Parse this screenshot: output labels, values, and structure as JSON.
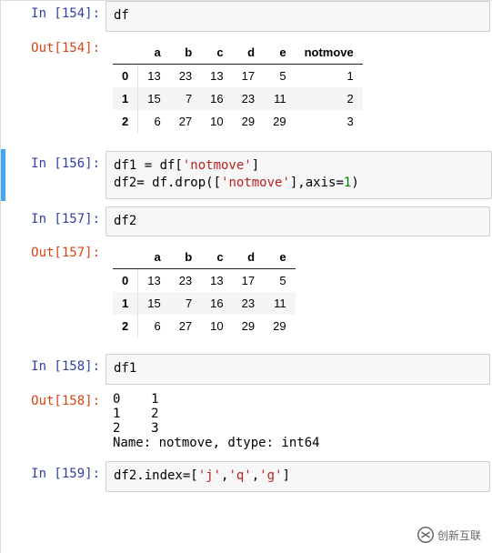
{
  "cells": {
    "c1": {
      "in_prompt": "In  [154]:",
      "code": "df"
    },
    "c1out": {
      "out_prompt": "Out[154]:",
      "table": {
        "columns": [
          "a",
          "b",
          "c",
          "d",
          "e",
          "notmove"
        ],
        "index": [
          "0",
          "1",
          "2"
        ],
        "data": [
          [
            13,
            23,
            13,
            17,
            5,
            1
          ],
          [
            15,
            7,
            16,
            23,
            11,
            2
          ],
          [
            6,
            27,
            10,
            29,
            29,
            3
          ]
        ]
      }
    },
    "c2": {
      "in_prompt": "In  [156]:",
      "tokens": {
        "t0": "df1 = df[",
        "t1": "'notmove'",
        "t2": "]\ndf2= df.drop([",
        "t3": "'notmove'",
        "t4": "],axis=",
        "t5": "1",
        "t6": ")"
      }
    },
    "c3": {
      "in_prompt": "In  [157]:",
      "code": "df2"
    },
    "c3out": {
      "out_prompt": "Out[157]:",
      "table": {
        "columns": [
          "a",
          "b",
          "c",
          "d",
          "e"
        ],
        "index": [
          "0",
          "1",
          "2"
        ],
        "data": [
          [
            13,
            23,
            13,
            17,
            5
          ],
          [
            15,
            7,
            16,
            23,
            11
          ],
          [
            6,
            27,
            10,
            29,
            29
          ]
        ]
      }
    },
    "c4": {
      "in_prompt": "In  [158]:",
      "code": "df1"
    },
    "c4out": {
      "out_prompt": "Out[158]:",
      "text": "0    1\n1    2\n2    3\nName: notmove, dtype: int64"
    },
    "c5": {
      "in_prompt": "In  [159]:",
      "tokens": {
        "t0": "df2.index=[",
        "t1": "'j'",
        "t2": ",",
        "t3": "'q'",
        "t4": ",",
        "t5": "'g'",
        "t6": "]"
      }
    }
  },
  "watermark": {
    "text": "创新互联"
  }
}
